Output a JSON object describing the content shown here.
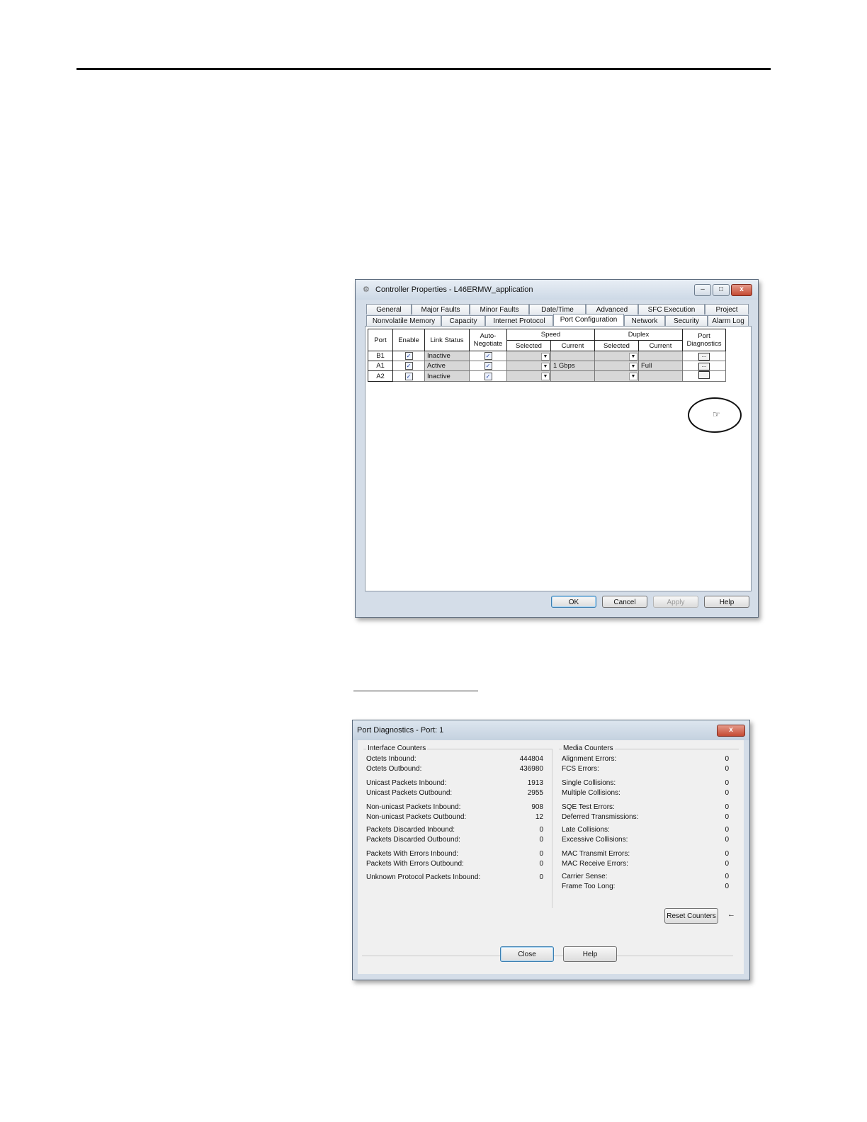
{
  "props_window": {
    "title": "Controller Properties - L46ERMW_application",
    "controls": {
      "minimize": "–",
      "maximize": "□",
      "close": "x"
    },
    "tabs_row1": [
      "General",
      "Major Faults",
      "Minor Faults",
      "Date/Time",
      "Advanced",
      "SFC Execution",
      "Project"
    ],
    "tabs_row2": [
      "Nonvolatile Memory",
      "Capacity",
      "Internet Protocol",
      "Port Configuration",
      "Network",
      "Security",
      "Alarm Log"
    ],
    "active_tab": "Port Configuration",
    "headers": {
      "port": "Port",
      "enable": "Enable",
      "link_status": "Link Status",
      "auto_negotiate": "Auto-\nNegotiate",
      "speed": "Speed",
      "duplex": "Duplex",
      "port_diagnostics": "Port\nDiagnostics",
      "selected": "Selected",
      "current": "Current"
    },
    "rows": [
      {
        "port": "B1",
        "enabled": true,
        "link_status": "Inactive",
        "auto_negotiate": true,
        "speed_current": "",
        "duplex_current": "",
        "diag": "..."
      },
      {
        "port": "A1",
        "enabled": true,
        "link_status": "Active",
        "auto_negotiate": true,
        "speed_current": "1 Gbps",
        "duplex_current": "Full",
        "diag": "..."
      },
      {
        "port": "A2",
        "enabled": true,
        "link_status": "Inactive",
        "auto_negotiate": true,
        "speed_current": "",
        "duplex_current": "",
        "diag": ""
      }
    ],
    "buttons": {
      "ok": "OK",
      "cancel": "Cancel",
      "apply": "Apply",
      "help": "Help"
    }
  },
  "diag_window": {
    "title": "Port Diagnostics - Port: 1",
    "close": "x",
    "interface_counters": {
      "label": "Interface Counters",
      "items": [
        {
          "label": "Octets Inbound:",
          "value": "444804"
        },
        {
          "label": "Octets Outbound:",
          "value": "436980"
        },
        {
          "label": "Unicast Packets Inbound:",
          "value": "1913"
        },
        {
          "label": "Unicast Packets Outbound:",
          "value": "2955"
        },
        {
          "label": "Non-unicast Packets Inbound:",
          "value": "908"
        },
        {
          "label": "Non-unicast Packets Outbound:",
          "value": "12"
        },
        {
          "label": "Packets Discarded Inbound:",
          "value": "0"
        },
        {
          "label": "Packets Discarded Outbound:",
          "value": "0"
        },
        {
          "label": "Packets With Errors Inbound:",
          "value": "0"
        },
        {
          "label": "Packets With Errors Outbound:",
          "value": "0"
        },
        {
          "label": "Unknown Protocol Packets Inbound:",
          "value": "0"
        }
      ]
    },
    "media_counters": {
      "label": "Media Counters",
      "items": [
        {
          "label": "Alignment Errors:",
          "value": "0"
        },
        {
          "label": "FCS Errors:",
          "value": "0"
        },
        {
          "label": "Single Collisions:",
          "value": "0"
        },
        {
          "label": "Multiple Collisions:",
          "value": "0"
        },
        {
          "label": "SQE Test Errors:",
          "value": "0"
        },
        {
          "label": "Deferred Transmissions:",
          "value": "0"
        },
        {
          "label": "Late Collisions:",
          "value": "0"
        },
        {
          "label": "Excessive Collisions:",
          "value": "0"
        },
        {
          "label": "MAC Transmit Errors:",
          "value": "0"
        },
        {
          "label": "MAC Receive Errors:",
          "value": "0"
        },
        {
          "label": "Carrier Sense:",
          "value": "0"
        },
        {
          "label": "Frame Too Long:",
          "value": "0"
        }
      ]
    },
    "buttons": {
      "reset": "Reset Counters",
      "close": "Close",
      "help": "Help"
    },
    "arrow": "←"
  }
}
